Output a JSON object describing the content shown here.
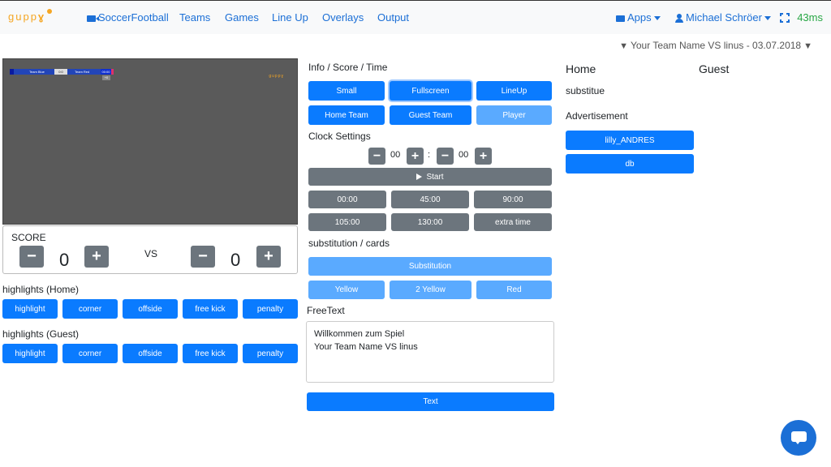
{
  "nav": {
    "logo": "gupp",
    "links": [
      "SoccerFootball",
      "Teams",
      "Games",
      "Line Up",
      "Overlays",
      "Output"
    ],
    "apps": "Apps",
    "user": "Michael Schröer",
    "latency": "43ms"
  },
  "game_title": "Your Team Name VS linus - 03.07.2018",
  "preview": {
    "home_team": "Team Blue",
    "score": "0:0",
    "guest_team": "Team Red",
    "time": "00:00",
    "tag": "+0"
  },
  "score": {
    "label": "SCORE",
    "home": "0",
    "vs": "VS",
    "guest": "0"
  },
  "highlights_home": {
    "label": "highlights (Home)",
    "buttons": [
      "highlight",
      "corner",
      "offside",
      "free kick",
      "penalty"
    ]
  },
  "highlights_guest": {
    "label": "highlights (Guest)",
    "buttons": [
      "highlight",
      "corner",
      "offside",
      "free kick",
      "penalty"
    ]
  },
  "info": {
    "label": "Info / Score / Time",
    "row1": [
      "Small",
      "Fullscreen",
      "LineUp"
    ],
    "row2": [
      "Home Team",
      "Guest Team",
      "Player"
    ]
  },
  "clock": {
    "label": "Clock Settings",
    "minutes": "00",
    "separator": ":",
    "seconds": "00",
    "start": "Start",
    "presets": [
      "00:00",
      "45:00",
      "90:00",
      "105:00",
      "130:00",
      "extra time"
    ]
  },
  "cards": {
    "label": "substitution / cards",
    "substitution": "Substitution",
    "yellow": "Yellow",
    "two_yellow": "2 Yellow",
    "red": "Red"
  },
  "freetext": {
    "label": "FreeText",
    "value": "Willkommen zum Spiel\nYour Team Name VS linus",
    "button": "Text"
  },
  "right": {
    "home": "Home",
    "guest": "Guest",
    "substitue": "substitue",
    "advertisement": "Advertisement",
    "ads": [
      "lilly_ANDRES",
      "db"
    ]
  },
  "colors": {
    "primary": "#0a7bff",
    "primary_light": "#5aaaff",
    "secondary": "#6c757d",
    "nav_link": "#1b6fd6",
    "latency": "#28a745"
  }
}
